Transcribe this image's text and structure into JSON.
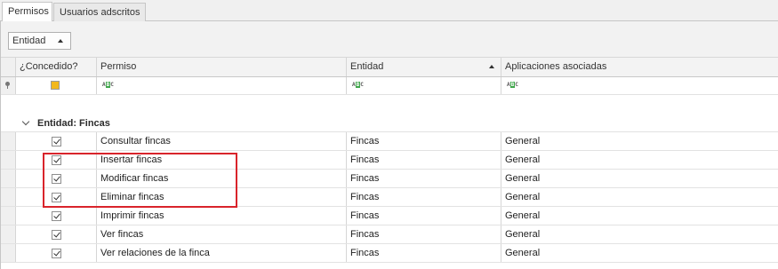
{
  "tabs": [
    {
      "label": "Permisos",
      "active": true
    },
    {
      "label": "Usuarios adscritos",
      "active": false
    }
  ],
  "group_panel": {
    "chip_label": "Entidad",
    "sort": "ascending"
  },
  "columns": [
    {
      "label": "¿Concedido?"
    },
    {
      "label": "Permiso"
    },
    {
      "label": "Entidad",
      "sorted": "ascending"
    },
    {
      "label": "Aplicaciones  asociadas"
    }
  ],
  "filter_row": {
    "icon": "abc-filter-icon",
    "abc": {
      "a": "A",
      "b": "B",
      "c": "C"
    }
  },
  "group": {
    "label": "Entidad: Fincas"
  },
  "rows": [
    {
      "granted": true,
      "permiso": "Consultar fincas",
      "entidad": "Fincas",
      "aplicaciones": "General"
    },
    {
      "granted": true,
      "permiso": "Insertar fincas",
      "entidad": "Fincas",
      "aplicaciones": "General"
    },
    {
      "granted": true,
      "permiso": "Modificar fincas",
      "entidad": "Fincas",
      "aplicaciones": "General"
    },
    {
      "granted": true,
      "permiso": "Eliminar fincas",
      "entidad": "Fincas",
      "aplicaciones": "General"
    },
    {
      "granted": true,
      "permiso": "Imprimir fincas",
      "entidad": "Fincas",
      "aplicaciones": "General"
    },
    {
      "granted": true,
      "permiso": "Ver fincas",
      "entidad": "Fincas",
      "aplicaciones": "General"
    },
    {
      "granted": true,
      "permiso": "Ver relaciones de la finca",
      "entidad": "Fincas",
      "aplicaciones": "General"
    }
  ],
  "highlight": {
    "color": "#d9242b"
  },
  "colors": {
    "filter_checkbox": "#f2b81e",
    "abc_icon": "#3ea64a"
  }
}
